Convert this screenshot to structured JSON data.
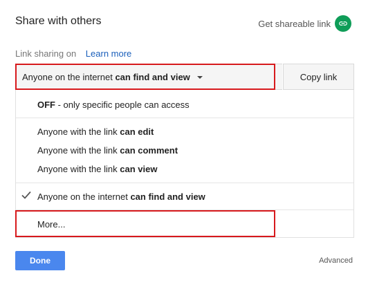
{
  "header": {
    "title": "Share with others",
    "shareable_link_label": "Get shareable link",
    "shareable_link_icon": "link-icon"
  },
  "link_sharing": {
    "label": "Link sharing on",
    "learn_more": "Learn more"
  },
  "dropdown": {
    "selected_prefix": "Anyone on the internet ",
    "selected_bold": "can find and view",
    "caret_icon": "caret-down-icon"
  },
  "copy_link_label": "Copy link",
  "menu": {
    "off_bold": "OFF",
    "off_rest": " - only specific people can access",
    "link_edit_prefix": "Anyone with the link ",
    "link_edit_bold": "can edit",
    "link_comment_prefix": "Anyone with the link ",
    "link_comment_bold": "can comment",
    "link_view_prefix": "Anyone with the link ",
    "link_view_bold": "can view",
    "internet_prefix": "Anyone on the internet ",
    "internet_bold": "can find and view",
    "check_icon": "checkmark-icon",
    "more": "More..."
  },
  "footer": {
    "done_label": "Done",
    "advanced_label": "Advanced"
  },
  "colors": {
    "accent_blue": "#4a87ee",
    "link_green": "#0f9d58",
    "highlight_red": "#d7191c",
    "link_text": "#1a5fbb"
  }
}
